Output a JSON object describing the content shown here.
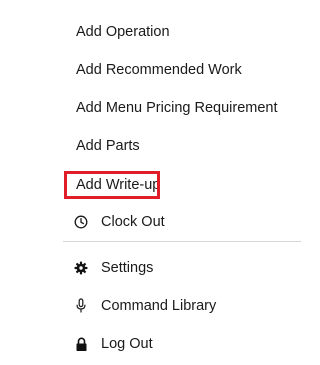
{
  "menu": {
    "items": [
      {
        "label": "Add Operation"
      },
      {
        "label": "Add Recommended Work"
      },
      {
        "label": "Add Menu Pricing Requirement"
      },
      {
        "label": "Add Parts"
      },
      {
        "label": "Add Write-up"
      }
    ],
    "clock_out": {
      "label": "Clock Out",
      "icon": "clock-icon"
    },
    "secondary": [
      {
        "label": "Settings",
        "icon": "gear-icon"
      },
      {
        "label": "Command Library",
        "icon": "microphone-icon"
      },
      {
        "label": "Log Out",
        "icon": "lock-icon"
      }
    ]
  },
  "highlight": {
    "color": "#e01e2a",
    "target": "Add Write-up"
  }
}
